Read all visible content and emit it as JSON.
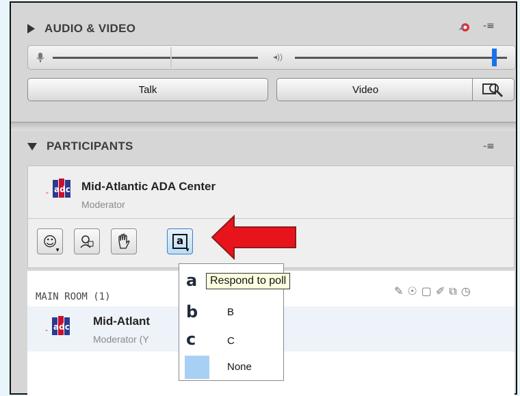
{
  "audio_video": {
    "title": "AUDIO & VIDEO",
    "talk_label": "Talk",
    "video_label": "Video"
  },
  "participants": {
    "title": "PARTICIPANTS",
    "self": {
      "name": "Mid-Atlantic ADA Center",
      "role": "Moderator"
    },
    "room_label": "MAIN ROOM (1)",
    "row": {
      "name": "Mid-Atlant",
      "role": "Moderator (Y"
    }
  },
  "poll_menu": {
    "tooltip": "Respond to poll",
    "options": [
      {
        "letter": "a",
        "label": ""
      },
      {
        "letter": "b",
        "label": "B"
      },
      {
        "letter": "c",
        "label": "C"
      },
      {
        "letter": "",
        "label": "None"
      }
    ]
  },
  "colors": {
    "accent": "#1a73e8",
    "arrow": "#e8141c",
    "tooltip_bg": "#ffffe1",
    "none_swatch": "#a8d0f4"
  },
  "icons": [
    "gear-icon",
    "menu-icon",
    "microphone-icon",
    "speaker-icon",
    "camera-settings-icon",
    "emoticon-icon",
    "profile-icon",
    "raise-hand-icon",
    "poll-icon"
  ]
}
